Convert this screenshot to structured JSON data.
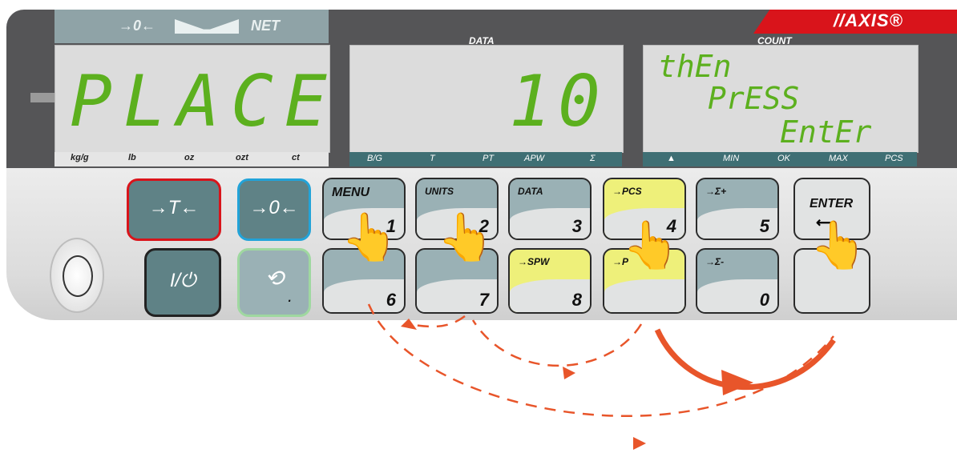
{
  "brand": {
    "logo_text": "//AXIS®"
  },
  "labels": {
    "data": "DATA",
    "count": "COUNT"
  },
  "net_indicator": {
    "zero_symbol": "→0←",
    "net": "NET"
  },
  "displays": {
    "weight": "PLACE",
    "data": "10",
    "count_line1": "thEn",
    "count_line2": "PrESS",
    "count_line3": "EntEr"
  },
  "weight_units": [
    "kg/g",
    "lb",
    "oz",
    "ozt",
    "ct"
  ],
  "data_indicators": [
    "B/G",
    "T",
    "PT",
    "APW",
    "Σ"
  ],
  "count_indicators": [
    "▲",
    "MIN",
    "OK",
    "MAX",
    "PCS"
  ],
  "keys": {
    "tare": "→T←",
    "zero": "→0←",
    "power": "I/⏻",
    "cycle_dot": ".",
    "menu": {
      "label": "MENU",
      "num": "1"
    },
    "units": {
      "label": "UNITS",
      "num": "2"
    },
    "data": {
      "label": "DATA",
      "num": "3"
    },
    "pcs": {
      "label": "→PCS",
      "num": "4"
    },
    "sum_plus": {
      "label": "→Σ+",
      "num": "5"
    },
    "enter": {
      "label": "ENTER",
      "num": ""
    },
    "k6": {
      "label": "",
      "num": "6"
    },
    "k7": {
      "label": "",
      "num": "7"
    },
    "spw": {
      "label": "→SPW",
      "num": "8"
    },
    "k9": {
      "label": "→P",
      "num": ""
    },
    "sum_minus": {
      "label": "→Σ-",
      "num": "0"
    }
  },
  "colors": {
    "accent_red": "#d9141b",
    "lcd_green": "#5cb01e",
    "arrow": "#e8552a",
    "key_yellow": "#eef07a"
  }
}
